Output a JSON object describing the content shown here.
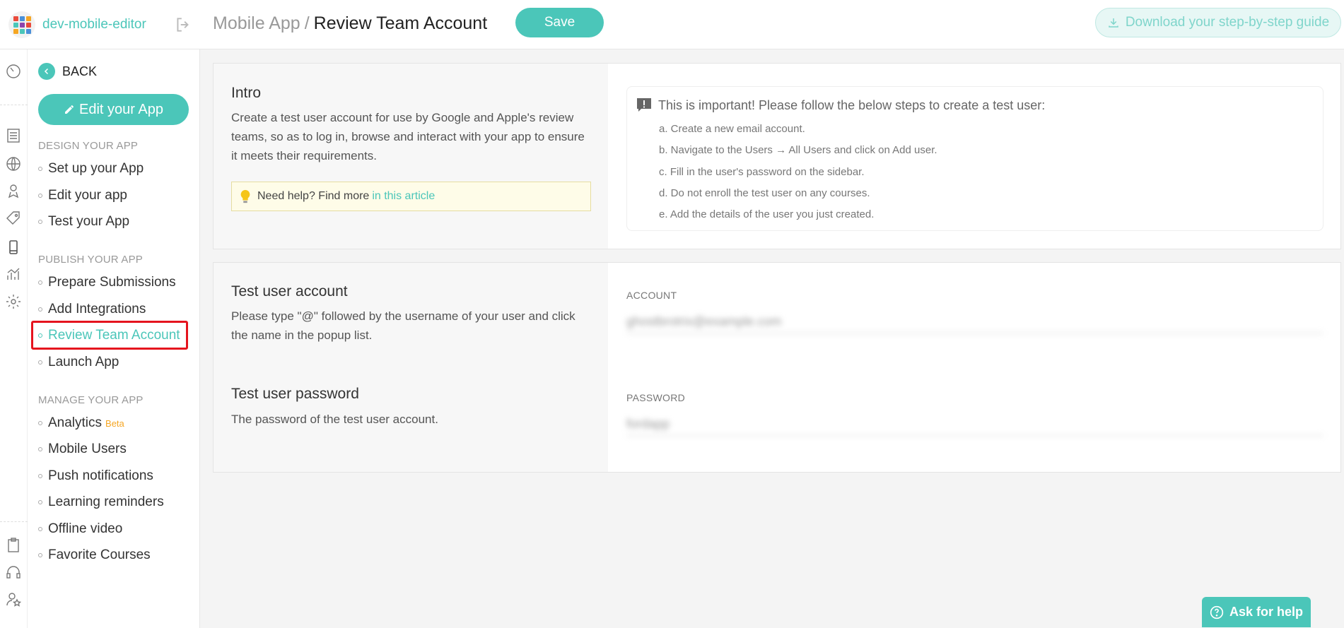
{
  "header": {
    "org_name": "dev-mobile-editor",
    "breadcrumb_parent": "Mobile App",
    "breadcrumb_separator": "/",
    "breadcrumb_current": "Review Team Account",
    "save_label": "Save",
    "download_label": "Download your step-by-step guide"
  },
  "sidebar": {
    "back_label": "BACK",
    "edit_app_label": "Edit your App",
    "sections": [
      {
        "title": "DESIGN YOUR APP",
        "items": [
          "Set up your App",
          "Edit your app",
          "Test your App"
        ]
      },
      {
        "title": "PUBLISH YOUR APP",
        "items": [
          "Prepare Submissions",
          "Add Integrations",
          "Review Team Account",
          "Launch App"
        ]
      },
      {
        "title": "MANAGE YOUR APP",
        "items": [
          "Analytics",
          "Mobile Users",
          "Push notifications",
          "Learning reminders",
          "Offline video",
          "Favorite Courses"
        ]
      }
    ],
    "active_item": "Review Team Account",
    "beta_label": "Beta"
  },
  "intro": {
    "title": "Intro",
    "description": "Create a test user account for use by Google and Apple's review teams, so as to log in, browse and interact with your app to ensure it meets their requirements.",
    "help_text": "Need help? Find more",
    "help_link": "in this article",
    "important_title": "This is important! Please follow the below steps to create a test user:",
    "steps": [
      "a. Create a new email account.",
      "b. Navigate to the Users → All Users and click on Add user.",
      "c. Fill in the user's password on the sidebar.",
      "d. Do not enroll the test user on any courses.",
      "e. Add the details of the user you just created."
    ]
  },
  "account": {
    "title": "Test user account",
    "description": "Please type \"@\" followed by the username of your user and click the name in the popup list.",
    "field_label": "ACCOUNT",
    "field_value": "ghostbrotrix@example.com"
  },
  "password": {
    "title": "Test user password",
    "description": "The password of the test user account.",
    "field_label": "PASSWORD",
    "field_value": "fordapp"
  },
  "ask_help_label": "Ask for help",
  "colors": {
    "accent": "#4bc6b9",
    "highlight": "#e5141e",
    "beta": "#f5a623"
  }
}
